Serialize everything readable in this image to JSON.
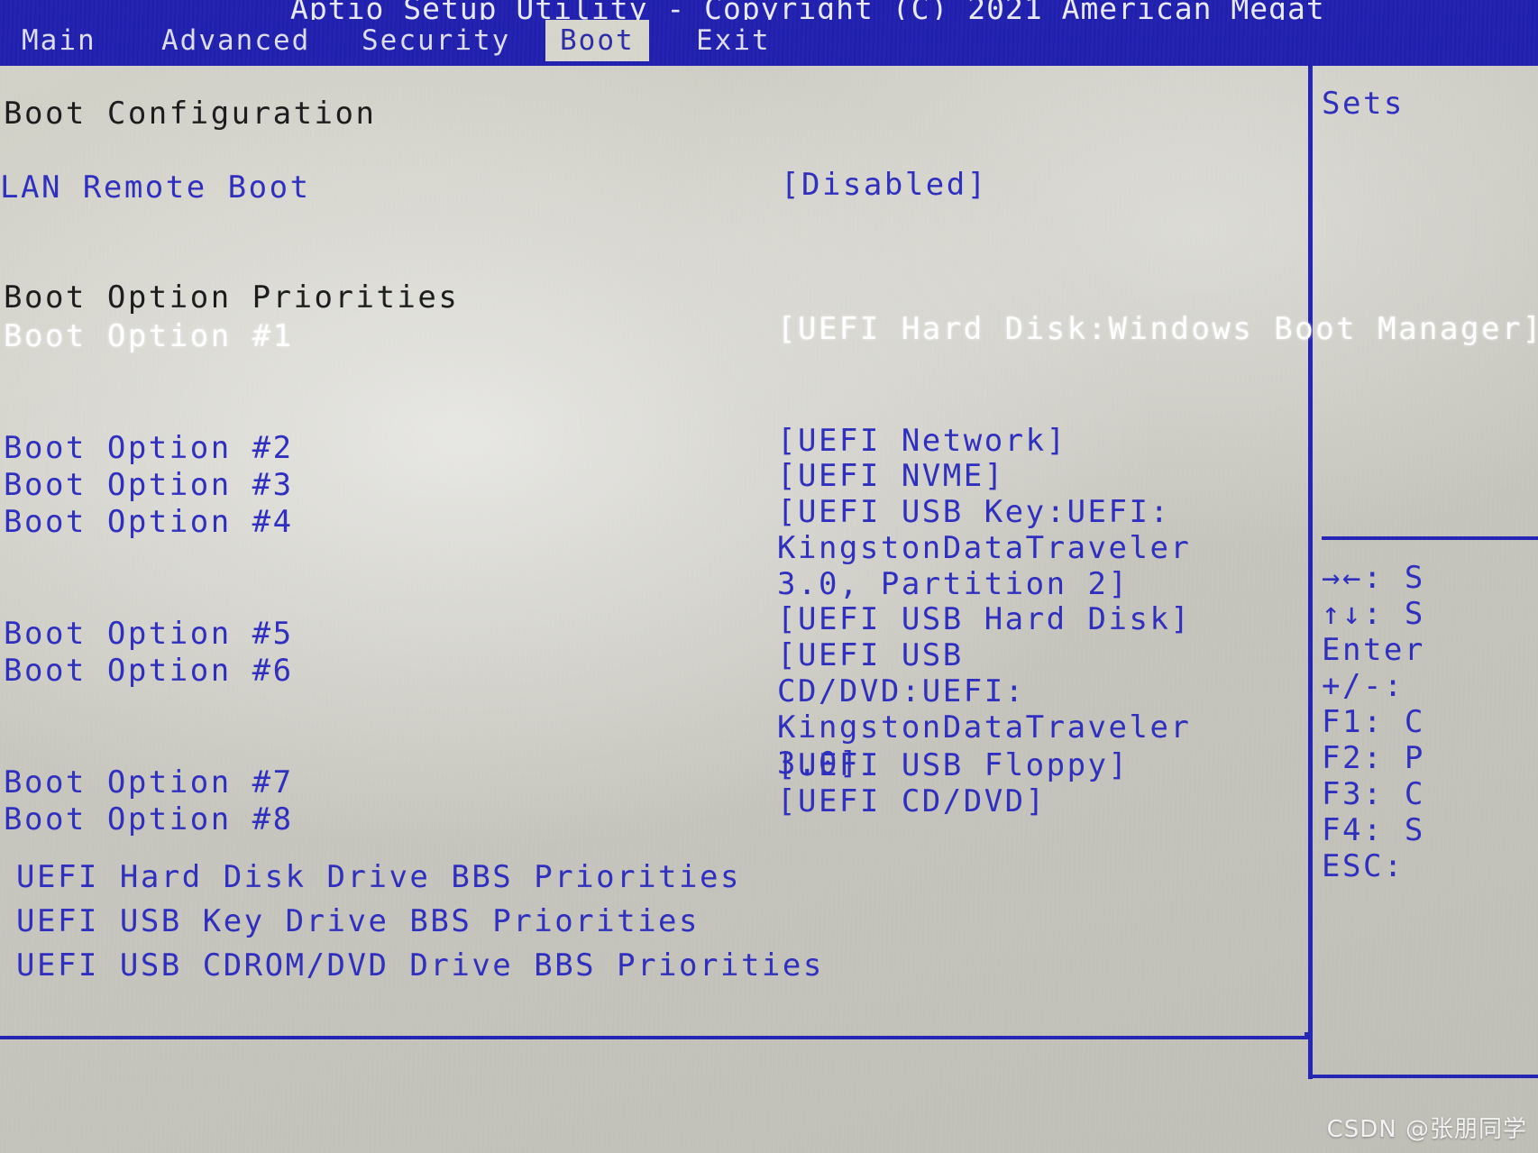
{
  "header": {
    "title": "Aptio Setup Utility - Copyright (C) 2021 American Megat",
    "tabs": [
      {
        "label": "Main",
        "active": false
      },
      {
        "label": "Advanced",
        "active": false
      },
      {
        "label": "Security",
        "active": false
      },
      {
        "label": "Boot",
        "active": true
      },
      {
        "label": "Exit",
        "active": false
      }
    ]
  },
  "main": {
    "section_title": "Boot Configuration",
    "lan_remote_boot": {
      "label": "LAN Remote Boot",
      "value": "[Disabled]"
    },
    "priorities_title": "Boot Option Priorities",
    "boot_options": [
      {
        "label": "Boot Option #1",
        "value": "[UEFI Hard Disk:Windows Boot Manager]",
        "selected": true
      },
      {
        "label": "Boot Option #2",
        "value": "[UEFI Network]",
        "selected": false
      },
      {
        "label": "Boot Option #3",
        "value": "[UEFI NVME]",
        "selected": false
      },
      {
        "label": "Boot Option #4",
        "value": "[UEFI USB Key:UEFI: KingstonDataTraveler 3.0, Partition 2]",
        "selected": false
      },
      {
        "label": "Boot Option #5",
        "value": "[UEFI USB Hard Disk]",
        "selected": false
      },
      {
        "label": "Boot Option #6",
        "value": "[UEFI USB CD/DVD:UEFI: KingstonDataTraveler 3.0]",
        "selected": false
      },
      {
        "label": "Boot Option #7",
        "value": "[UEFI USB Floppy]",
        "selected": false
      },
      {
        "label": "Boot Option #8",
        "value": "[UEFI CD/DVD]",
        "selected": false
      }
    ],
    "bbs_links": [
      "UEFI Hard Disk Drive BBS Priorities",
      "UEFI USB Key Drive BBS Priorities",
      "UEFI USB CDROM/DVD Drive BBS Priorities"
    ]
  },
  "help": {
    "description": "Sets",
    "keys": [
      "→←: S",
      "↑↓: S",
      "Enter",
      "+/-:",
      "F1: C",
      "F2: P",
      "F3: C",
      "F4: S",
      "ESC:"
    ]
  },
  "watermark": "CSDN @张朋同学",
  "colors": {
    "chrome_blue": "#1f1fae",
    "text_blue": "#2d2dbe",
    "selected_white": "#ffffff",
    "background": "#c9c8c0"
  }
}
